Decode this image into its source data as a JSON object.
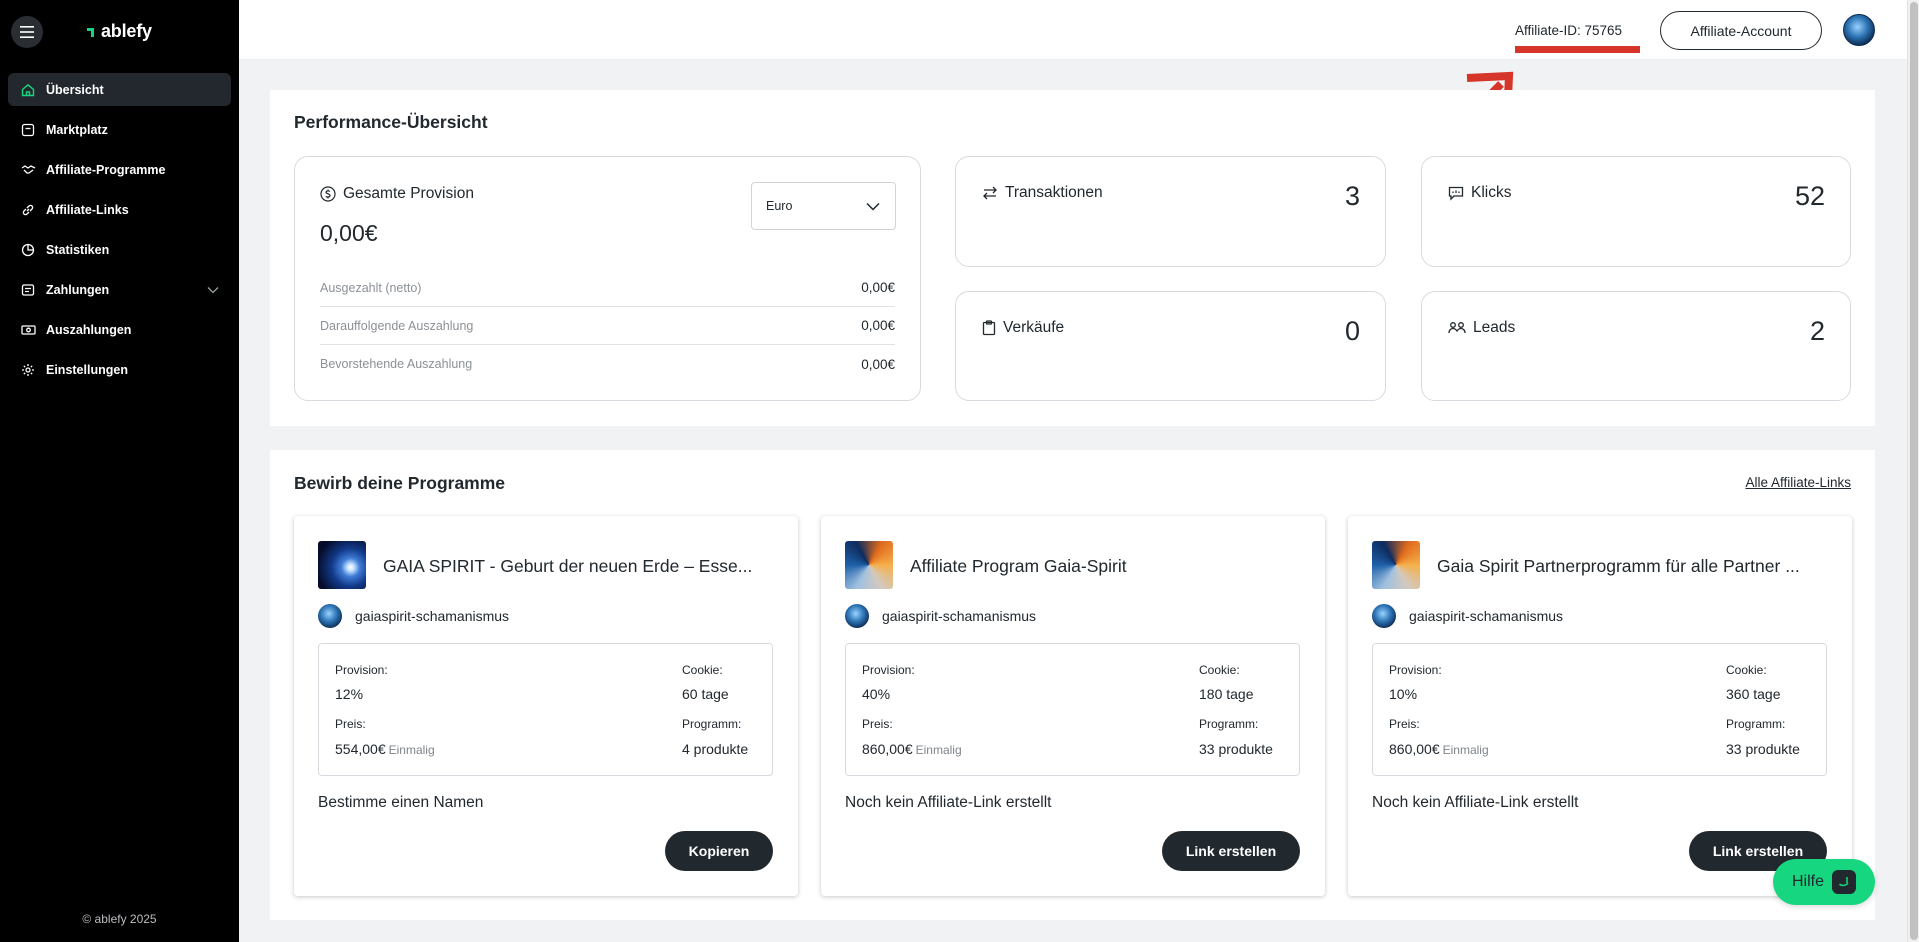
{
  "brand": {
    "name": "ablefy",
    "copyright": "© ablefy 2025",
    "accent": "#16d77f"
  },
  "sidebar": {
    "items": [
      {
        "label": "Übersicht",
        "icon": "home-icon",
        "active": true
      },
      {
        "label": "Marktplatz",
        "icon": "marketplace-icon"
      },
      {
        "label": "Affiliate-Programme",
        "icon": "handshake-icon"
      },
      {
        "label": "Affiliate-Links",
        "icon": "link-icon"
      },
      {
        "label": "Statistiken",
        "icon": "chart-pie-icon"
      },
      {
        "label": "Zahlungen",
        "icon": "payments-icon",
        "expandable": true
      },
      {
        "label": "Auszahlungen",
        "icon": "cash-icon"
      },
      {
        "label": "Einstellungen",
        "icon": "gear-icon"
      }
    ]
  },
  "topbar": {
    "affiliate_id_label": "Affiliate-ID: 75765",
    "account_button": "Affiliate-Account",
    "highlight_color": "#d6352a"
  },
  "performance": {
    "title": "Performance-Übersicht",
    "provision": {
      "title": "Gesamte Provision",
      "amount": "0,00€",
      "currency": "Euro",
      "rows": [
        {
          "label": "Ausgezahlt (netto)",
          "value": "0,00€"
        },
        {
          "label": "Darauffolgende Auszahlung",
          "value": "0,00€"
        },
        {
          "label": "Bevorstehende Auszahlung",
          "value": "0,00€"
        }
      ]
    },
    "stats": {
      "transaktionen": {
        "label": "Transaktionen",
        "value": "3"
      },
      "klicks": {
        "label": "Klicks",
        "value": "52"
      },
      "verkaeufe": {
        "label": "Verkäufe",
        "value": "0"
      },
      "leads": {
        "label": "Leads",
        "value": "2"
      }
    }
  },
  "programs": {
    "title": "Bewirb deine Programme",
    "all_links": "Alle Affiliate-Links",
    "labels": {
      "provision": "Provision:",
      "cookie": "Cookie:",
      "preis": "Preis:",
      "programm": "Programm:"
    },
    "cards": [
      {
        "title": "GAIA SPIRIT - Geburt der neuen Erde – Esse...",
        "seller": "gaiaspirit-schamanismus",
        "provision": "12%",
        "cookie": "60 tage",
        "price": "554,00€",
        "price_type": "Einmalig",
        "program": "4 produkte",
        "link_text": "Bestimme einen Namen",
        "action": "Kopieren"
      },
      {
        "title": "Affiliate Program Gaia-Spirit",
        "seller": "gaiaspirit-schamanismus",
        "provision": "40%",
        "cookie": "180 tage",
        "price": "860,00€",
        "price_type": "Einmalig",
        "program": "33 produkte",
        "link_text": "Noch kein Affiliate-Link erstellt",
        "action": "Link erstellen"
      },
      {
        "title": "Gaia Spirit Partnerprogramm für alle Partner ...",
        "seller": "gaiaspirit-schamanismus",
        "provision": "10%",
        "cookie": "360 tage",
        "price": "860,00€",
        "price_type": "Einmalig",
        "program": "33 produkte",
        "link_text": "Noch kein Affiliate-Link erstellt",
        "action": "Link erstellen"
      }
    ]
  },
  "help": {
    "label": "Hilfe"
  }
}
